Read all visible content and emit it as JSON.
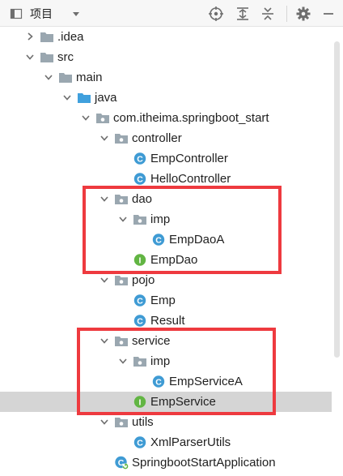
{
  "toolbar": {
    "project_label": "项目",
    "icons": [
      "project-view-icon",
      "dropdown-arrow-icon",
      "locate-target-icon",
      "expand-all-icon",
      "collapse-all-icon",
      "settings-gear-icon",
      "minimize-icon"
    ]
  },
  "tree": {
    "nodes": [
      {
        "label": ".idea",
        "icon": "folder",
        "expanded": false
      },
      {
        "label": "src",
        "icon": "folder",
        "expanded": true
      },
      {
        "label": "main",
        "icon": "folder",
        "expanded": true
      },
      {
        "label": "java",
        "icon": "source-folder",
        "expanded": true
      },
      {
        "label": "com.itheima.springboot_start",
        "icon": "package",
        "expanded": true
      },
      {
        "label": "controller",
        "icon": "package",
        "expanded": true
      },
      {
        "label": "EmpController",
        "icon": "class"
      },
      {
        "label": "HelloController",
        "icon": "class"
      },
      {
        "label": "dao",
        "icon": "package",
        "expanded": true
      },
      {
        "label": "imp",
        "icon": "package",
        "expanded": true
      },
      {
        "label": "EmpDaoA",
        "icon": "class"
      },
      {
        "label": "EmpDao",
        "icon": "interface"
      },
      {
        "label": "pojo",
        "icon": "package",
        "expanded": true
      },
      {
        "label": "Emp",
        "icon": "class"
      },
      {
        "label": "Result",
        "icon": "class"
      },
      {
        "label": "service",
        "icon": "package",
        "expanded": true
      },
      {
        "label": "imp",
        "icon": "package",
        "expanded": true
      },
      {
        "label": "EmpServiceA",
        "icon": "class"
      },
      {
        "label": "EmpService",
        "icon": "interface",
        "selected": true
      },
      {
        "label": "utils",
        "icon": "package",
        "expanded": true
      },
      {
        "label": "XmlParserUtils",
        "icon": "class"
      },
      {
        "label": "SpringbootStartApplication",
        "icon": "spring-boot-class"
      }
    ]
  },
  "colors": {
    "highlight_box": "#ee3a3f",
    "selected_row": "#d5d5d5",
    "class_icon": "#3f9bd4",
    "interface_icon": "#62b543",
    "folder": "#9aa7b0",
    "source_folder": "#40a0dd"
  }
}
